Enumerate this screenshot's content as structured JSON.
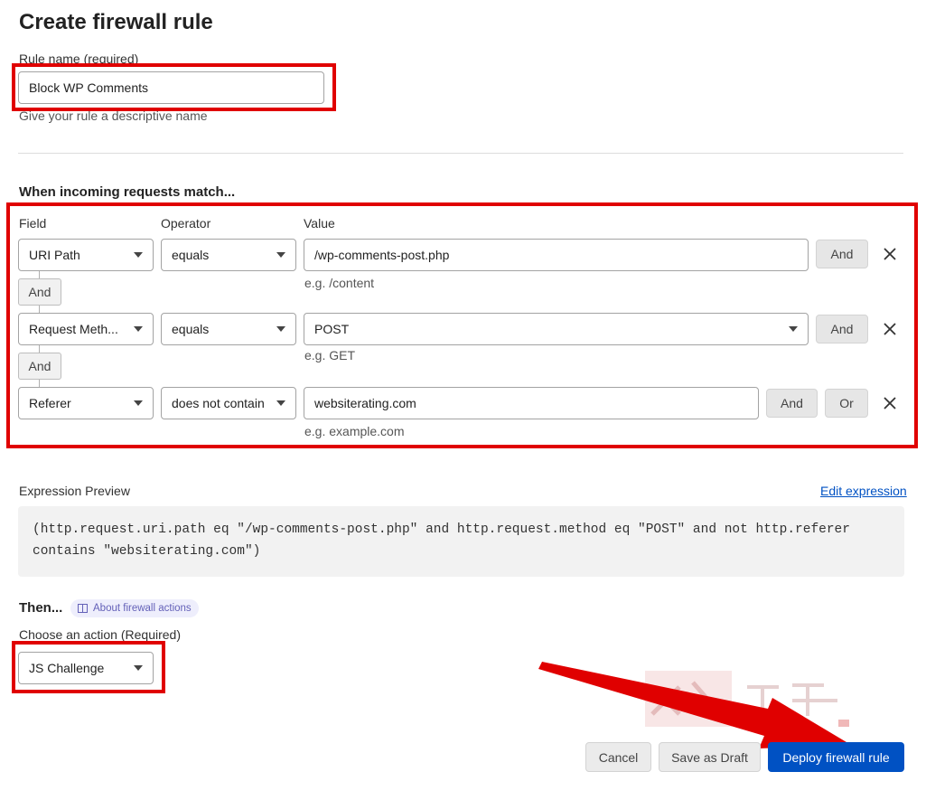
{
  "page": {
    "title": "Create firewall rule"
  },
  "rule_name": {
    "label": "Rule name (required)",
    "value": "Block WP Comments",
    "help": "Give your rule a descriptive name"
  },
  "match": {
    "heading": "When incoming requests match...",
    "col_field": "Field",
    "col_operator": "Operator",
    "col_value": "Value",
    "rows": [
      {
        "field": "URI Path",
        "operator": "equals",
        "value": "/wp-comments-post.php",
        "hint": "e.g. /content",
        "and_label": "And"
      },
      {
        "field": "Request Meth...",
        "operator": "equals",
        "value": "POST",
        "hint": "e.g. GET",
        "and_label": "And"
      },
      {
        "field": "Referer",
        "operator": "does not contain",
        "value": "websiterating.com",
        "hint": "e.g. example.com",
        "and_label": "And",
        "or_label": "Or"
      }
    ],
    "joins": [
      "And",
      "And"
    ]
  },
  "expression": {
    "label": "Expression Preview",
    "edit_link": "Edit expression",
    "line1": "(http.request.uri.path eq \"/wp-comments-post.php\" and http.request.method eq \"POST\" and not http.referer",
    "line2": "contains \"websiterating.com\")"
  },
  "then": {
    "heading": "Then...",
    "about_link": "About firewall actions",
    "action_label": "Choose an action (Required)",
    "action_value": "JS Challenge"
  },
  "footer": {
    "cancel": "Cancel",
    "save_draft": "Save as Draft",
    "deploy": "Deploy firewall rule"
  },
  "colors": {
    "highlight": "#e00000",
    "primary": "#0051c3",
    "link": "#0051c3"
  },
  "icons": [
    "close-icon",
    "chevron-down-icon",
    "book-icon",
    "arrow-annotation"
  ]
}
